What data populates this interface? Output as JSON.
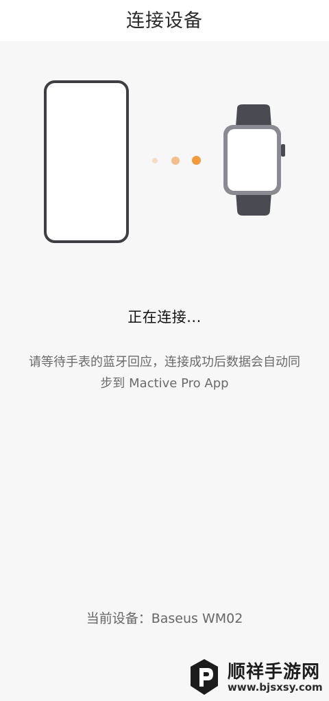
{
  "header": {
    "title": "连接设备"
  },
  "illustration": {
    "phone_icon": "phone-outline-icon",
    "watch_icon": "smartwatch-icon",
    "dot_colors": [
      "#f7dcc2",
      "#f4be8e",
      "#f29a3c"
    ]
  },
  "status": {
    "text": "正在连接..."
  },
  "description": {
    "text": "请等待手表的蓝牙回应，连接成功后数据会自动同步到 Mactive Pro App"
  },
  "device": {
    "label": "当前设备：",
    "name": "Baseus WM02"
  },
  "watermark": {
    "site_name": "顺祥手游网",
    "url": "www.bjsxsy.com"
  },
  "colors": {
    "accent": "#f29a3c",
    "background": "#f7f7f7",
    "header_bg": "#ffffff"
  }
}
